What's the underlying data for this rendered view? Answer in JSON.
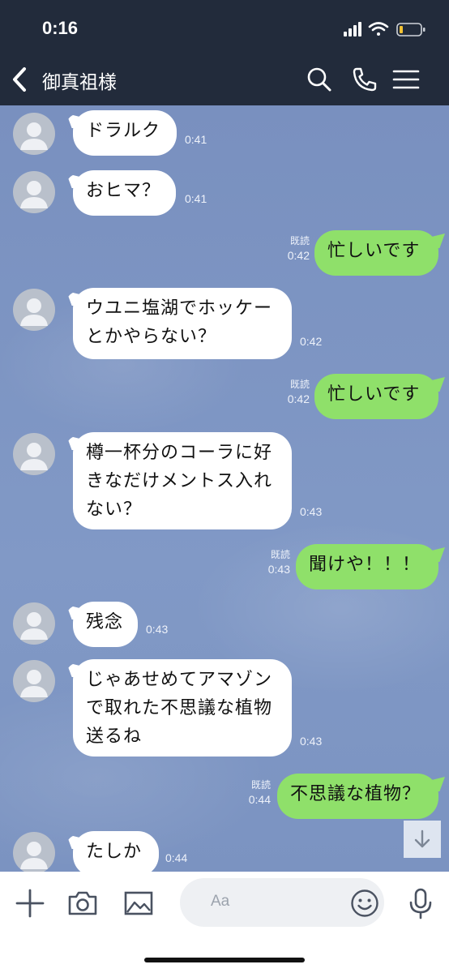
{
  "status_bar": {
    "time": "0:16"
  },
  "header": {
    "title": "御真祖様"
  },
  "messages": [
    {
      "side": "in",
      "text": "ドラルク",
      "time": "0:41"
    },
    {
      "side": "in",
      "text": "おヒマ？",
      "time": "0:41"
    },
    {
      "side": "out",
      "text": "忙しいです",
      "time": "0:42",
      "read": "既読"
    },
    {
      "side": "in",
      "lines": [
        "ウユニ塩湖でホッケー",
        "とかやらない？"
      ],
      "time": "0:42"
    },
    {
      "side": "out",
      "text": "忙しいです",
      "time": "0:42",
      "read": "既読"
    },
    {
      "side": "in",
      "lines": [
        "樽一杯分のコーラに好",
        "きなだけメントス入れ",
        "ない？"
      ],
      "time": "0:43"
    },
    {
      "side": "out",
      "text": "聞けや！！！",
      "time": "0:43",
      "read": "既読"
    },
    {
      "side": "in",
      "text": "残念",
      "time": "0:43"
    },
    {
      "side": "in",
      "lines": [
        "じゃあせめてアマゾン",
        "で取れた不思議な植物",
        "送るね"
      ],
      "time": "0:43"
    },
    {
      "side": "out",
      "text": "不思議な植物？",
      "time": "0:44",
      "read": "既読"
    },
    {
      "side": "in",
      "text": "たしか",
      "time": "0:44"
    }
  ],
  "composer": {
    "placeholder": "Aa"
  },
  "icons": {
    "back": "chevron-left-icon",
    "search": "search-icon",
    "call": "phone-icon",
    "menu": "menu-icon",
    "plus": "plus-icon",
    "camera": "camera-icon",
    "image": "image-icon",
    "emoji": "emoji-icon",
    "mic": "microphone-icon",
    "scroll": "arrow-down-icon",
    "avatar": "default-avatar-icon"
  },
  "colors": {
    "header_bg": "#222b3b",
    "chat_bg": "#7f97c3",
    "outgoing_bubble": "#8fe06a",
    "incoming_bubble": "#ffffff"
  }
}
